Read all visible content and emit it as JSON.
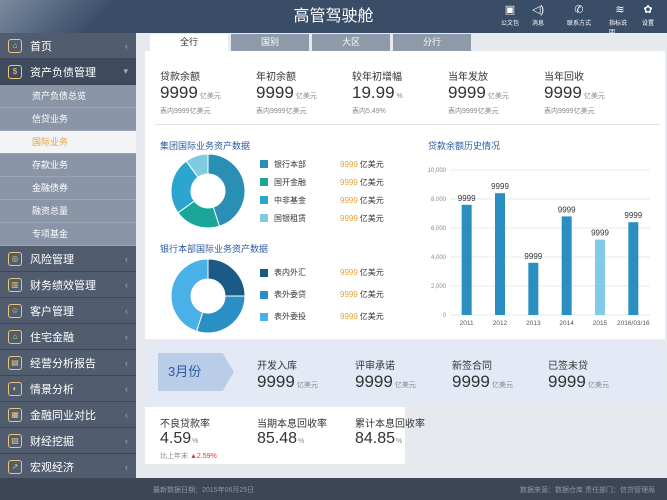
{
  "header": {
    "title": "高管驾驶舱",
    "icons": [
      {
        "name": "briefcase-icon",
        "glyph": "▣",
        "label": "公文包"
      },
      {
        "name": "speaker-icon",
        "glyph": "◁)",
        "label": "消息"
      },
      {
        "name": "phone-icon",
        "glyph": "✆",
        "label": "联系方式"
      },
      {
        "name": "layers-icon",
        "glyph": "≋",
        "label": "指标说明"
      },
      {
        "name": "gear-icon",
        "glyph": "✿",
        "label": "设置"
      }
    ]
  },
  "sidebar": {
    "items": [
      {
        "label": "首页",
        "glyph": "⌂"
      },
      {
        "label": "资产负债管理",
        "glyph": "$"
      }
    ],
    "subitems": [
      "资产负债总览",
      "信贷业务",
      "国际业务",
      "存款业务",
      "金融债券",
      "融资总量",
      "专项基金"
    ],
    "items2": [
      {
        "label": "风险管理",
        "glyph": "◎"
      },
      {
        "label": "财务绩效管理",
        "glyph": "▥"
      },
      {
        "label": "客户管理",
        "glyph": "☺"
      },
      {
        "label": "住宅金融",
        "glyph": "⌂"
      },
      {
        "label": "经营分析报告",
        "glyph": "▤"
      },
      {
        "label": "情景分析",
        "glyph": "◐"
      },
      {
        "label": "金融同业对比",
        "glyph": "▦"
      },
      {
        "label": "财经挖掘",
        "glyph": "▧"
      },
      {
        "label": "宏观经济",
        "glyph": "↗"
      }
    ]
  },
  "tabs": [
    "全行",
    "国别",
    "大区",
    "分行"
  ],
  "metrics": [
    {
      "label": "贷款余额",
      "value": "9999",
      "unit": "亿美元",
      "sub": "表内9999亿美元"
    },
    {
      "label": "年初余额",
      "value": "9999",
      "unit": "亿美元",
      "sub": "表内9999亿美元"
    },
    {
      "label": "较年初增幅",
      "value": "19.99",
      "unit": "%",
      "sub": "表内5.49%"
    },
    {
      "label": "当年发放",
      "value": "9999",
      "unit": "亿美元",
      "sub": "表内9999亿美元"
    },
    {
      "label": "当年回收",
      "value": "9999",
      "unit": "亿美元",
      "sub": "表内9999亿美元"
    }
  ],
  "donut1": {
    "title": "集团国际业务资产数据",
    "entries": [
      {
        "name": "银行本部",
        "value": "9999",
        "unit": "亿美元",
        "color": "#2a8fb5",
        "share": 0.45
      },
      {
        "name": "国开金融",
        "value": "9999",
        "unit": "亿美元",
        "color": "#1aa79a",
        "share": 0.2
      },
      {
        "name": "中非基金",
        "value": "9999",
        "unit": "亿美元",
        "color": "#2aa6cf",
        "share": 0.25
      },
      {
        "name": "国银租赁",
        "value": "9999",
        "unit": "亿美元",
        "color": "#7fcbe0",
        "share": 0.1
      }
    ]
  },
  "donut2": {
    "title": "银行本部国际业务资产数据",
    "entries": [
      {
        "name": "表内外汇",
        "value": "9999",
        "unit": "亿美元",
        "color": "#1a5a86",
        "share": 0.25
      },
      {
        "name": "表外委贷",
        "value": "9999",
        "unit": "亿美元",
        "color": "#2a8fc5",
        "share": 0.3
      },
      {
        "name": "表外委投",
        "value": "9999",
        "unit": "亿美元",
        "color": "#4ab0e8",
        "share": 0.45
      }
    ]
  },
  "chart_data": {
    "type": "bar",
    "title": "贷款余额历史情况",
    "categories": [
      "2011",
      "2012",
      "2013",
      "2014",
      "2015",
      "2016/03/16"
    ],
    "values": [
      7600,
      8400,
      3600,
      6800,
      5200,
      6400
    ],
    "data_labels": [
      "9999",
      "9999",
      "9999",
      "9999",
      "9999",
      "9999"
    ],
    "ylim": [
      0,
      10000
    ],
    "yticks": [
      "0",
      "2,000",
      "4,000",
      "6,000",
      "8,000",
      "10,000"
    ],
    "colors": [
      "#2a8fc0",
      "#2a8fc0",
      "#2a8fc0",
      "#2a8fc0",
      "#7fcbe8",
      "#2a8fc0"
    ]
  },
  "month_tag": "3月份",
  "metrics2": [
    {
      "label": "开发入库",
      "value": "9999",
      "unit": "亿美元"
    },
    {
      "label": "评审承诺",
      "value": "9999",
      "unit": "亿美元"
    },
    {
      "label": "新签合同",
      "value": "9999",
      "unit": "亿美元"
    },
    {
      "label": "已签未贷",
      "value": "9999",
      "unit": "亿美元"
    }
  ],
  "metrics3": [
    {
      "label": "不良贷款率",
      "value": "4.59",
      "unit": "%",
      "cmp_label": "比上年末",
      "cmp_value": "2.59%"
    },
    {
      "label": "当期本息回收率",
      "value": "85.48",
      "unit": "%"
    },
    {
      "label": "累计本息回收率",
      "value": "84.85",
      "unit": "%"
    }
  ],
  "footer": {
    "left": "最新数据日期：2015年06月25日",
    "right": "数据来源：数据仓库    责任部门：信贷管理局"
  }
}
